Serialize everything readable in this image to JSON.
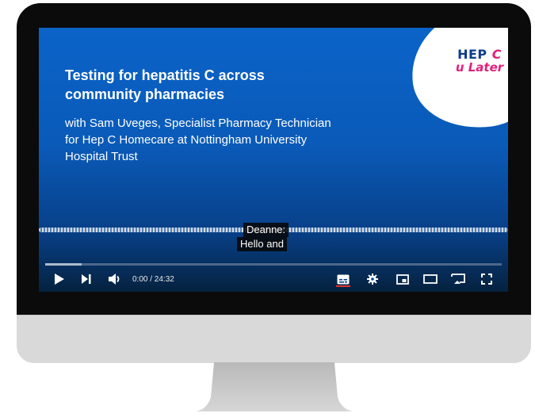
{
  "video": {
    "title": "Testing for hepatitis C across community pharmacies",
    "subtitle": "with Sam Uveges, Specialist Pharmacy Technician for Hep C Homecare at Nottingham University Hospital Trust",
    "logo": {
      "line1": "HEP",
      "line1_accent": "C",
      "line2": "u Later"
    },
    "captions": [
      "Deanne:",
      "Hello and"
    ]
  },
  "player": {
    "time_display": "0:00 / 24:32",
    "progress_fraction": 0.08,
    "controls": [
      "play-icon",
      "next-icon",
      "volume-icon",
      "subtitles-icon",
      "settings-icon",
      "miniplayer-icon",
      "theater-mode-icon",
      "cast-icon",
      "fullscreen-icon"
    ]
  },
  "colors": {
    "brand_pink": "#e0227a",
    "brand_navy": "#0d3d8c",
    "slide_blue": "#0b63c8",
    "cc_active_red": "#e5312e"
  }
}
